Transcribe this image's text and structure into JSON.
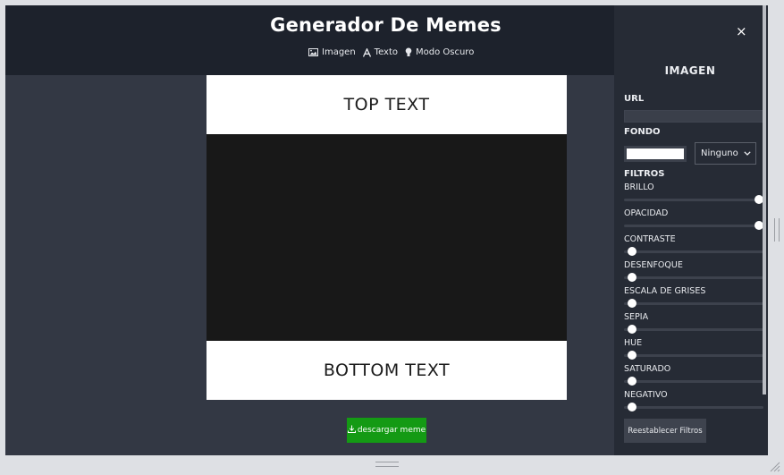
{
  "header": {
    "title": "Generador De Memes",
    "nav": [
      {
        "label": "Imagen",
        "icon": "image-icon"
      },
      {
        "label": "Texto",
        "icon": "text-icon"
      },
      {
        "label": "Modo Oscuro",
        "icon": "lightbulb-icon"
      }
    ]
  },
  "meme": {
    "top_text": "TOP TEXT",
    "bottom_text": "BOTTOM TEXT"
  },
  "download": {
    "label": "descargar meme",
    "icon": "download-icon"
  },
  "panel": {
    "close": "×",
    "title": "IMAGEN",
    "url_label": "URL",
    "url_value": "",
    "fondo_label": "FONDO",
    "fondo_color": "#ffffff",
    "blend_selected": "Ninguno",
    "filtros_label": "FILTROS",
    "filters": [
      {
        "label": "BRILLO",
        "value": 1
      },
      {
        "label": "OPACIDAD",
        "value": 1
      },
      {
        "label": "CONTRASTE",
        "value": 0
      },
      {
        "label": "DESENFOQUE",
        "value": 0
      },
      {
        "label": "ESCALA DE GRISES",
        "value": 0
      },
      {
        "label": "SEPIA",
        "value": 0
      },
      {
        "label": "HUE",
        "value": 0
      },
      {
        "label": "SATURADO",
        "value": 0
      },
      {
        "label": "NEGATIVO",
        "value": 0
      }
    ],
    "reset_label": "Reestablecer Filtros"
  },
  "colors": {
    "header_bg": "#1d222c",
    "main_bg": "#333844",
    "panel_bg": "#262b35",
    "download_bg": "#149a14",
    "meme_image_bg": "#181818"
  }
}
